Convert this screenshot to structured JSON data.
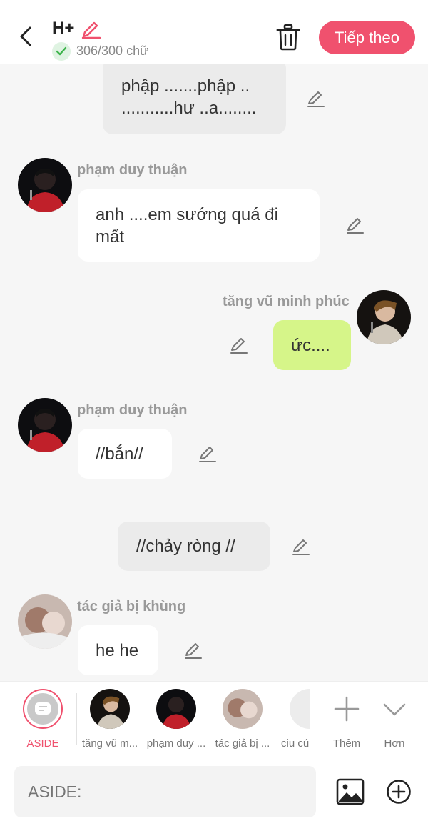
{
  "header": {
    "title": "H+",
    "word_count": "306/300 chữ",
    "next_label": "Tiếp theo",
    "accent_color": "#f0516e"
  },
  "messages": [
    {
      "type": "narration",
      "text_lines": [
        "phập .......phập ..",
        "...........hư ..a........"
      ]
    },
    {
      "type": "left",
      "name": "phạm duy thuận",
      "text_lines": [
        "anh ....em sướng quá đi",
        "mất"
      ]
    },
    {
      "type": "right",
      "name": "tăng vũ minh phúc",
      "text_lines": [
        "ức...."
      ]
    },
    {
      "type": "left",
      "name": "phạm duy thuận",
      "text_lines": [
        "//bắn//"
      ]
    },
    {
      "type": "narration",
      "text_lines": [
        "//chảy ròng //"
      ]
    },
    {
      "type": "left",
      "name": "tác giả bị khùng",
      "text_lines": [
        "he he"
      ]
    }
  ],
  "characters": [
    {
      "label": "ASIDE",
      "selected": true
    },
    {
      "label": "tăng vũ m..."
    },
    {
      "label": "phạm duy ..."
    },
    {
      "label": "tác giả bị ..."
    },
    {
      "label": "ciu cú"
    },
    {
      "label": "Thêm"
    },
    {
      "label": "Hơn"
    }
  ],
  "input": {
    "placeholder": "ASIDE:"
  }
}
